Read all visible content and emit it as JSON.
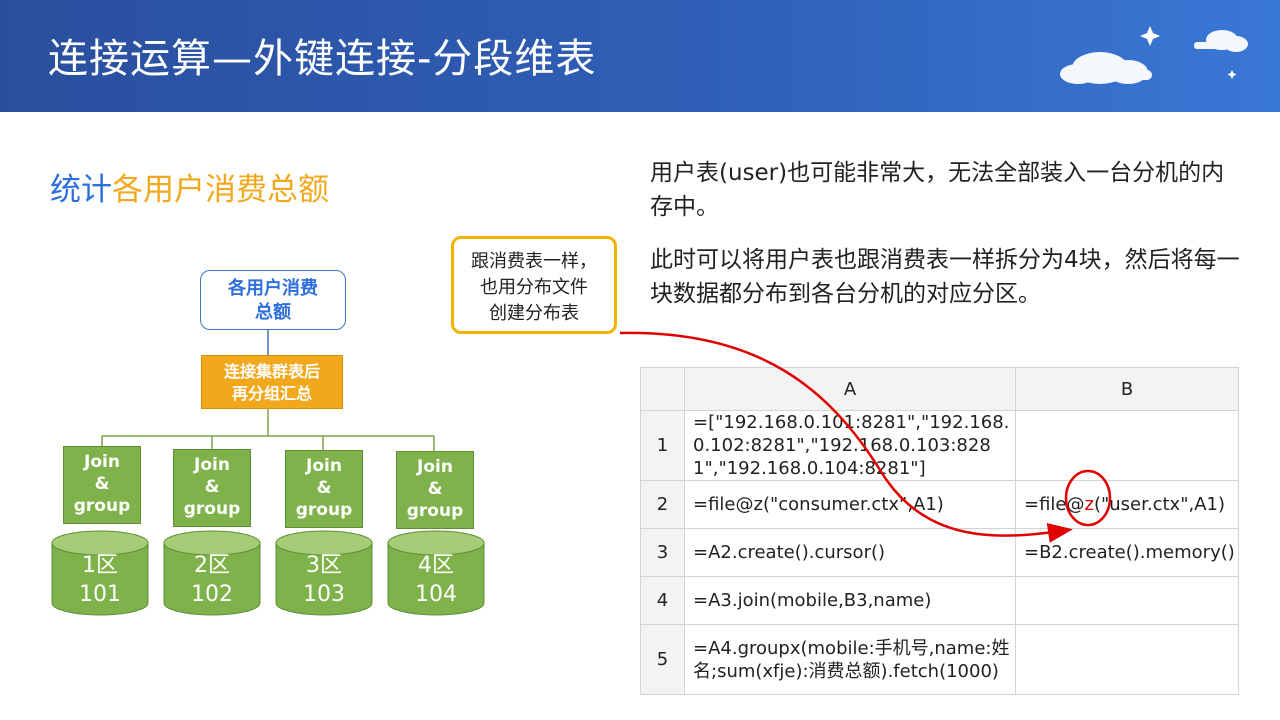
{
  "title": "连接运算—外键连接-分段维表",
  "subtitle": {
    "part1": "统计",
    "part2": "各用户消费总额"
  },
  "paragraphs": [
    "用户表(user)也可能非常大，无法全部装入一台分机的内存中。",
    "此时可以将用户表也跟消费表一样拆分为4块，然后将每一块数据都分布到各台分机的对应分区。"
  ],
  "callout": [
    "跟消费表一样，",
    "也用分布文件",
    "创建分布表"
  ],
  "diagram": {
    "top_box": [
      "各用户消费",
      "总额"
    ],
    "mid_box": [
      "连接集群表后",
      "再分组汇总"
    ],
    "join_boxes": [
      [
        "Join",
        "&",
        "group"
      ],
      [
        "Join",
        "&",
        "group"
      ],
      [
        "Join",
        "&",
        "group"
      ],
      [
        "Join",
        "&",
        "group"
      ]
    ],
    "partitions": [
      {
        "zone": "1区",
        "id": "101"
      },
      {
        "zone": "2区",
        "id": "102"
      },
      {
        "zone": "3区",
        "id": "103"
      },
      {
        "zone": "4区",
        "id": "104"
      }
    ]
  },
  "table": {
    "columns": [
      "",
      "A",
      "B"
    ],
    "rows": [
      {
        "num": "1",
        "a": "=[\"192.168.0.101:8281\",\"192.168.0.102:8281\",\"192.168.0.103:8281\",\"192.168.0.104:8281\"]",
        "b": ""
      },
      {
        "num": "2",
        "a": "=file@z(\"consumer.ctx\",A1)",
        "b": "=file@z(\"user.ctx\",A1)"
      },
      {
        "num": "3",
        "a": "=A2.create().cursor()",
        "b": "=B2.create().memory()"
      },
      {
        "num": "4",
        "a": "=A3.join(mobile,B3,name)",
        "b": ""
      },
      {
        "num": "5",
        "a": "=A4.groupx(mobile:手机号,name:姓名;sum(xfje):消费总额).fetch(1000)",
        "b": ""
      }
    ],
    "b2_parts": {
      "prefix": "=file@",
      "highlight": "z",
      "suffix": "(\"user.ctx\",A1)"
    }
  },
  "colors": {
    "banner": "#2f5fb6",
    "orange": "#f2a81d",
    "green": "#7fb24a",
    "blue": "#2f6fdc",
    "annotation_red": "#e00000"
  }
}
